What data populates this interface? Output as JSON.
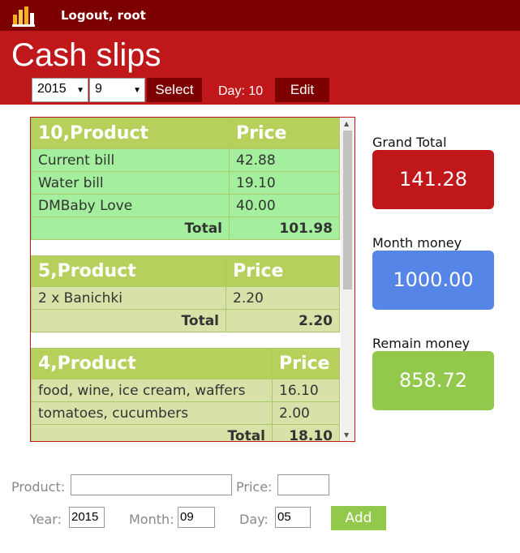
{
  "topbar": {
    "logout_label": "Logout, root"
  },
  "header": {
    "title": "Cash slips",
    "year_select": "2015",
    "month_select": "9",
    "select_label": "Select",
    "day_label": "Day: 10",
    "edit_label": "Edit"
  },
  "slips": [
    {
      "header": "10,Product",
      "price_header": "Price",
      "items": [
        {
          "product": "Current bill",
          "price": "42.88"
        },
        {
          "product": "Water bill",
          "price": "19.10"
        },
        {
          "product": "DMBaby Love",
          "price": "40.00"
        }
      ],
      "total_label": "Total",
      "total": "101.98"
    },
    {
      "header": "5,Product",
      "price_header": "Price",
      "items": [
        {
          "product": "2 x Banichki",
          "price": "2.20"
        }
      ],
      "total_label": "Total",
      "total": "2.20"
    },
    {
      "header": "4,Product",
      "price_header": "Price",
      "items": [
        {
          "product": "food, wine, ice cream, waffers",
          "price": "16.10"
        },
        {
          "product": "tomatoes, cucumbers",
          "price": "2.00"
        }
      ],
      "total_label": "Total",
      "total": "18.10"
    }
  ],
  "summary": {
    "grand_total_label": "Grand Total",
    "grand_total": "141.28",
    "month_money_label": "Month money",
    "month_money": "1000.00",
    "remain_money_label": "Remain money",
    "remain_money": "858.72"
  },
  "form": {
    "product_label": "Product:",
    "product_value": "",
    "price_label": "Price:",
    "price_value": "",
    "year_label": "Year:",
    "year_value": "2015",
    "month_label": "Month:",
    "month_value": "09",
    "day_label": "Day:",
    "day_value": "05",
    "add_label": "Add"
  },
  "colors": {
    "topbar": "#7d0000",
    "header": "#c0171b",
    "grand_total": "#c0171b",
    "month_money": "#5585e6",
    "remain_money": "#92c84b"
  }
}
